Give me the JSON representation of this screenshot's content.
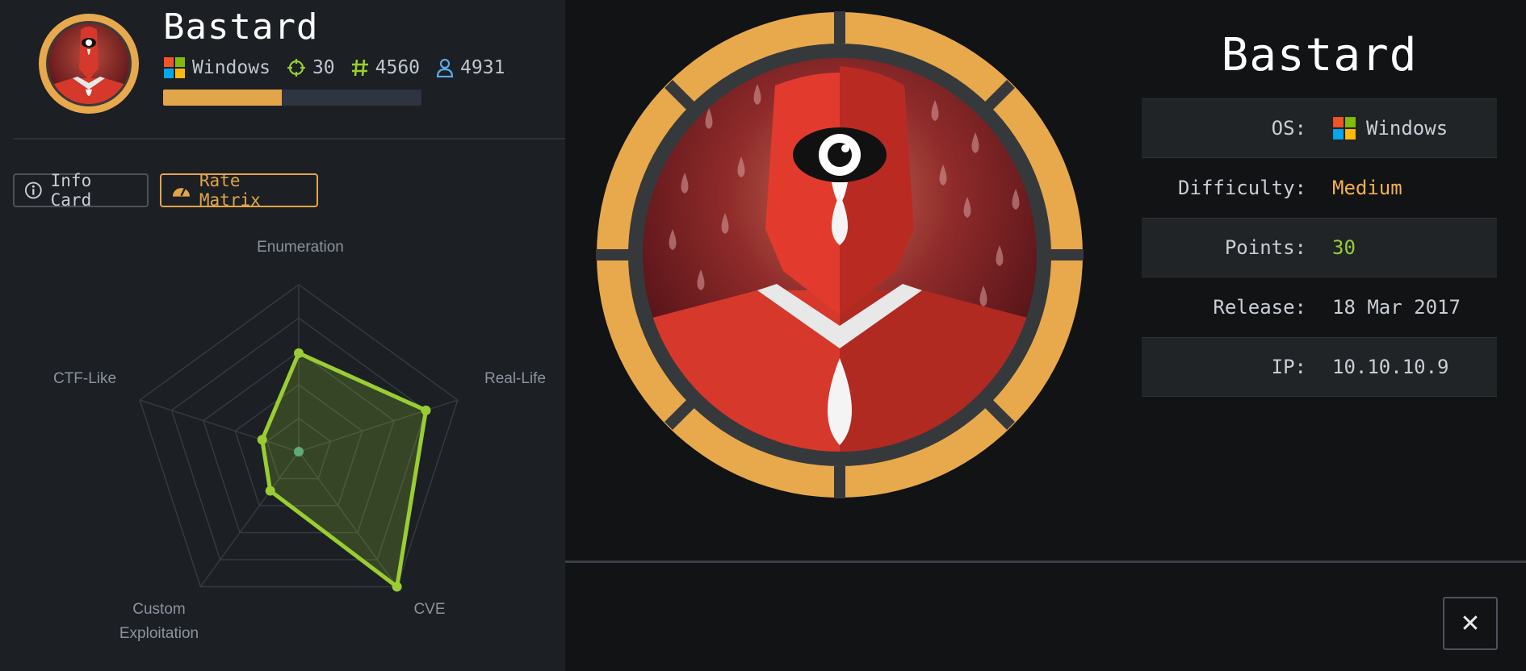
{
  "machine": {
    "name": "Bastard",
    "os": "Windows",
    "points": "30",
    "owns_root": "4560",
    "owns_user": "4931",
    "progress": 0.46
  },
  "tabs": [
    {
      "label": "Info Card",
      "icon": "info-circle-icon",
      "active": false
    },
    {
      "label": "Rate Matrix",
      "icon": "gauge-icon",
      "active": true
    }
  ],
  "chart_data": {
    "type": "radar",
    "axes": [
      "Enumeration",
      "Real-Life",
      "CVE",
      "Custom Exploitation",
      "CTF-Like"
    ],
    "axis_label_lines": {
      "enumeration": [
        "Enumeration"
      ],
      "real_life": [
        "Real-Life"
      ],
      "cve": [
        "CVE"
      ],
      "custom_exploitation": [
        "Custom",
        "Exploitation"
      ],
      "ctf_like": [
        "CTF-Like"
      ]
    },
    "series": [
      {
        "name": "",
        "values": [
          5.9,
          8.0,
          10.0,
          2.9,
          2.3
        ],
        "color": "#9acd32"
      }
    ],
    "range": [
      0,
      10
    ],
    "rings": 5
  },
  "info_card": {
    "title": "Bastard",
    "rows": [
      {
        "label": "OS:",
        "value": "Windows",
        "icon": "windows-icon",
        "color": "#c9ced6"
      },
      {
        "label": "Difficulty:",
        "value": "Medium",
        "color": "#f6b04a"
      },
      {
        "label": "Points:",
        "value": "30",
        "color": "#9acd32"
      },
      {
        "label": "Release:",
        "value": "18 Mar 2017",
        "color": "#c9ced6"
      },
      {
        "label": "IP:",
        "value": "10.10.10.9",
        "color": "#c9ced6"
      }
    ]
  },
  "close_symbol": "✕",
  "colors": {
    "accent": "#e2a548",
    "green": "#9acd32",
    "blue": "#5aa9e6",
    "badge_red": "#d9322a"
  }
}
